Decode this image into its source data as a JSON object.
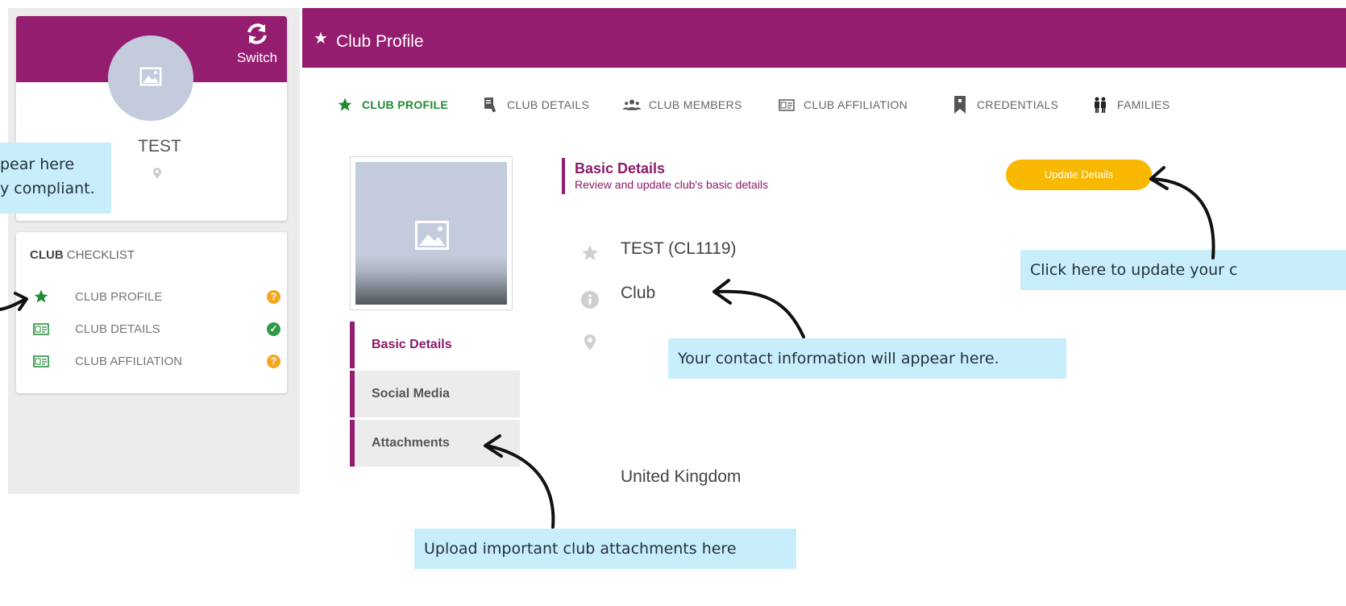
{
  "colors": {
    "brand": "#951d6f",
    "brand_text": "#8b1b68",
    "active_tab": "#1f8a36",
    "update_button": "#f9b800",
    "status_ok": "#2e9b43",
    "status_warn": "#f5a623",
    "callout_bg": "#c9eefb"
  },
  "profile": {
    "name": "TEST",
    "switch_label": "Switch",
    "icons": {
      "avatar": "image-icon",
      "switch": "refresh-icon",
      "location": "location-pin-icon"
    }
  },
  "checklist": {
    "title_bold": "CLUB",
    "title_rest": " CHECKLIST",
    "items": [
      {
        "label": "CLUB PROFILE",
        "icon": "star-icon",
        "status": "incomplete",
        "status_icon": "question-circle-icon"
      },
      {
        "label": "CLUB DETAILS",
        "icon": "id-card-icon",
        "status": "complete",
        "status_icon": "check-circle-icon"
      },
      {
        "label": "CLUB AFFILIATION",
        "icon": "id-card-icon",
        "status": "incomplete",
        "status_icon": "question-circle-icon"
      }
    ]
  },
  "header": {
    "title": "Club Profile",
    "icon": "star-icon"
  },
  "tabs": [
    {
      "label": "CLUB PROFILE",
      "icon": "star-icon",
      "active": true
    },
    {
      "label": "CLUB DETAILS",
      "icon": "document-pen-icon",
      "active": false
    },
    {
      "label": "CLUB MEMBERS",
      "icon": "people-icon",
      "active": false
    },
    {
      "label": "CLUB AFFILIATION",
      "icon": "id-card-icon",
      "active": false
    },
    {
      "label": "CREDENTIALS",
      "icon": "bookmark-icon",
      "active": false
    },
    {
      "label": "FAMILIES",
      "icon": "family-icon",
      "active": false
    }
  ],
  "side_tabs": [
    {
      "label": "Basic Details",
      "active": true
    },
    {
      "label": "Social Media",
      "active": false
    },
    {
      "label": "Attachments",
      "active": false
    }
  ],
  "section": {
    "title": "Basic Details",
    "subtitle": "Review and update club's basic details",
    "update_button": "Update Details"
  },
  "details": {
    "name": "TEST (CL1119)",
    "type": "Club",
    "address": "",
    "country": "United Kingdom"
  },
  "callouts": {
    "top_left_line1": "pear here",
    "top_left_line2": "y compliant.",
    "update_hint": "Click here to update your c",
    "contact_hint": "Your contact information will appear here.",
    "attachments_hint": "Upload important club attachments here"
  }
}
